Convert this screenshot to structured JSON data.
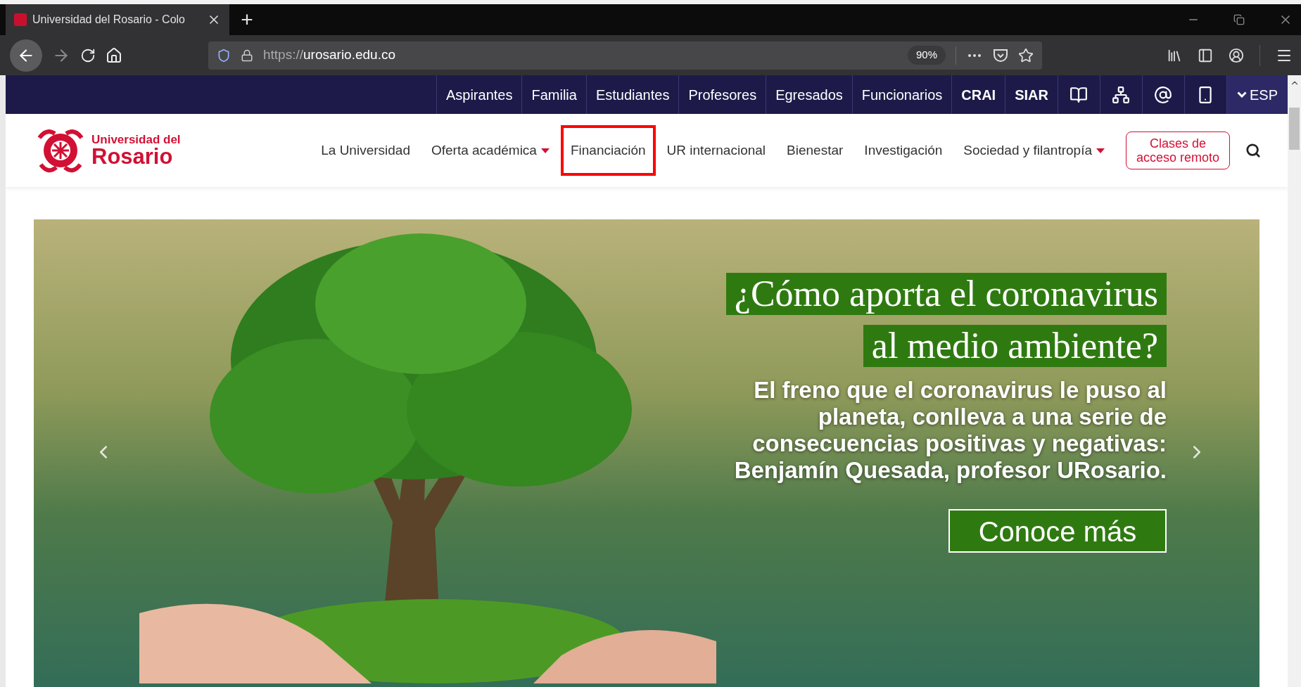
{
  "browser": {
    "tab": {
      "title": "Universidad del Rosario - Colo",
      "selected": true
    },
    "new_tab": "+",
    "url": {
      "scheme": "https://",
      "host": "urosario.edu.co"
    },
    "zoom": "90%"
  },
  "utility_bar": {
    "links": [
      {
        "label": "Aspirantes",
        "bold": false
      },
      {
        "label": "Familia",
        "bold": false
      },
      {
        "label": "Estudiantes",
        "bold": false
      },
      {
        "label": "Profesores",
        "bold": false
      },
      {
        "label": "Egresados",
        "bold": false
      },
      {
        "label": "Funcionarios",
        "bold": false
      },
      {
        "label": "CRAI",
        "bold": true
      },
      {
        "label": "SIAR",
        "bold": true
      }
    ],
    "language": "ESP"
  },
  "header": {
    "logo": {
      "line_1": "Universidad del",
      "line_2": "Rosario"
    },
    "nav": [
      {
        "label": "La Universidad",
        "dropdown": false,
        "highlighted": false
      },
      {
        "label": "Oferta académica",
        "dropdown": true,
        "highlighted": false
      },
      {
        "label": "Financiación",
        "dropdown": false,
        "highlighted": true
      },
      {
        "label": "UR internacional",
        "dropdown": false,
        "highlighted": false
      },
      {
        "label": "Bienestar",
        "dropdown": false,
        "highlighted": false
      },
      {
        "label": "Investigación",
        "dropdown": false,
        "highlighted": false
      },
      {
        "label": "Sociedad y filantropía",
        "dropdown": true,
        "highlighted": false
      }
    ],
    "remote_button": "Clases de acceso remoto"
  },
  "hero": {
    "headline": [
      "¿Cómo aporta el coronavirus",
      "al medio ambiente?"
    ],
    "subtitle": "El freno que el coronavirus le puso al planeta, conlleva a una serie de consecuencias positivas y negativas: Benjamín Quesada, profesor URosario.",
    "button": "Conoce más"
  }
}
